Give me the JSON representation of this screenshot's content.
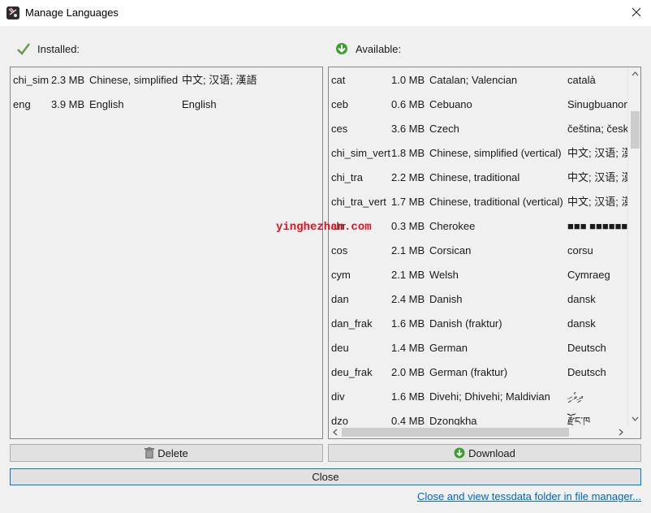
{
  "window": {
    "title": "Manage Languages",
    "close_label": "Close window"
  },
  "installed": {
    "header": "Installed:",
    "rows": [
      {
        "code": "chi_sim",
        "size": "2.3 MB",
        "name": "Chinese, simplified",
        "native": "中文; 汉语; 漢語"
      },
      {
        "code": "eng",
        "size": "3.9 MB",
        "name": "English",
        "native": "English"
      }
    ]
  },
  "available": {
    "header": "Available:",
    "rows": [
      {
        "code": "cat",
        "size": "1.0 MB",
        "name": "Catalan; Valencian",
        "native": "català"
      },
      {
        "code": "ceb",
        "size": "0.6 MB",
        "name": "Cebuano",
        "native": "Sinugbuanon"
      },
      {
        "code": "ces",
        "size": "3.6 MB",
        "name": "Czech",
        "native": "čeština; český jazyk"
      },
      {
        "code": "chi_sim_vert",
        "size": "1.8 MB",
        "name": "Chinese, simplified (vertical)",
        "native": "中文; 汉语; 漢語"
      },
      {
        "code": "chi_tra",
        "size": "2.2 MB",
        "name": "Chinese, traditional",
        "native": "中文; 汉语; 漢語"
      },
      {
        "code": "chi_tra_vert",
        "size": "1.7 MB",
        "name": "Chinese, traditional (vertical)",
        "native": "中文; 汉语; 漢語"
      },
      {
        "code": "chr",
        "size": "0.3 MB",
        "name": "Cherokee",
        "native": "■■■ ■■■■■■■"
      },
      {
        "code": "cos",
        "size": "2.1 MB",
        "name": "Corsican",
        "native": "corsu"
      },
      {
        "code": "cym",
        "size": "2.1 MB",
        "name": "Welsh",
        "native": "Cymraeg"
      },
      {
        "code": "dan",
        "size": "2.4 MB",
        "name": "Danish",
        "native": "dansk"
      },
      {
        "code": "dan_frak",
        "size": "1.6 MB",
        "name": "Danish (fraktur)",
        "native": "dansk"
      },
      {
        "code": "deu",
        "size": "1.4 MB",
        "name": "German",
        "native": "Deutsch"
      },
      {
        "code": "deu_frak",
        "size": "2.0 MB",
        "name": "German (fraktur)",
        "native": "Deutsch"
      },
      {
        "code": "div",
        "size": "1.6 MB",
        "name": "Divehi; Dhivehi; Maldivian",
        "native": "ދިވެހި"
      },
      {
        "code": "dzo",
        "size": "0.4 MB",
        "name": "Dzongkha",
        "native": "རྫོང་ཁ"
      }
    ]
  },
  "buttons": {
    "delete": "Delete",
    "download": "Download",
    "close": "Close"
  },
  "link": "Close and view tessdata folder in file manager...",
  "watermark": "yinghezhan.com",
  "colors": {
    "link": "#0066cc",
    "focus_border": "#0078d7",
    "green_icon": "#3aa02c"
  }
}
